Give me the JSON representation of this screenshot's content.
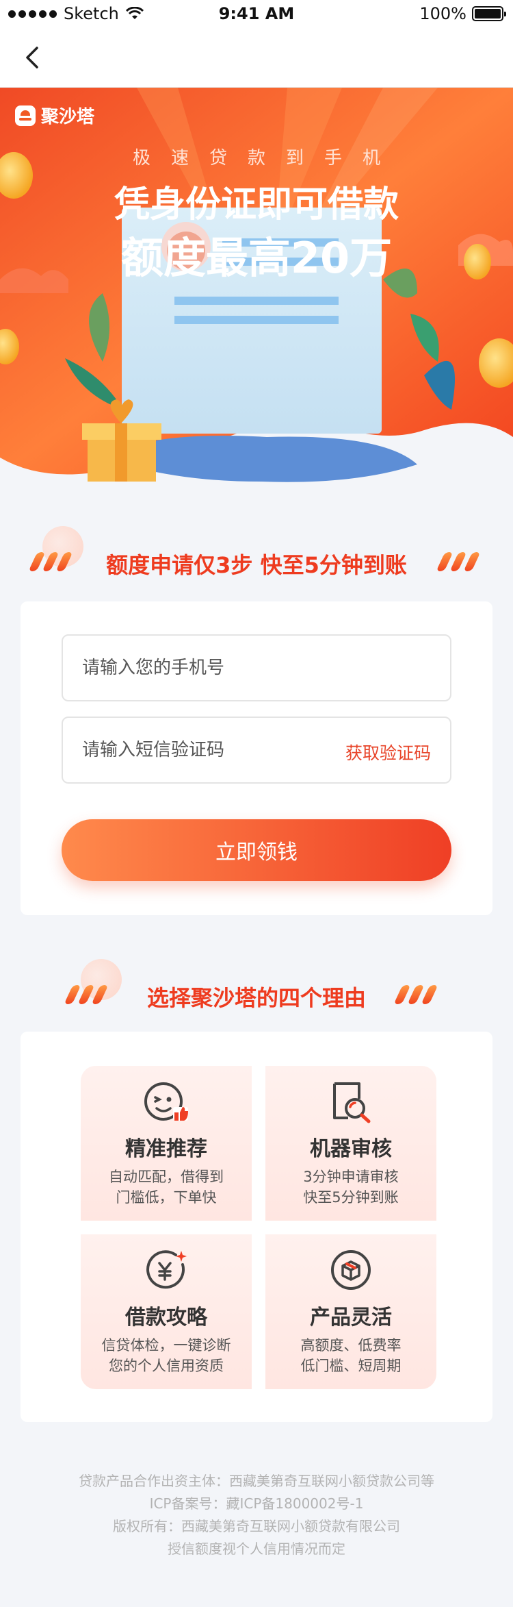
{
  "status_bar": {
    "carrier": "Sketch",
    "time": "9:41 AM",
    "battery": "100%",
    "battery_level": 1.0
  },
  "nav": {
    "back_icon": "chevron-left-icon"
  },
  "hero": {
    "logo_text": "聚沙塔",
    "subtitle": "极速贷款到手机",
    "title_line1": "凭身份证即可借款",
    "title_line2": "额度最高20万"
  },
  "apply_section": {
    "title": "额度申请仅3步 快至5分钟到账"
  },
  "form": {
    "phone_placeholder": "请输入您的手机号",
    "code_placeholder": "请输入短信验证码",
    "get_code_label": "获取验证码",
    "submit_label": "立即领钱"
  },
  "reasons_section": {
    "title": "选择聚沙塔的四个理由",
    "items": [
      {
        "icon": "smiley-thumbs-up-icon",
        "title": "精准推荐",
        "desc_line1": "自动匹配，借得到",
        "desc_line2": "门槛低，下单快"
      },
      {
        "icon": "search-document-icon",
        "title": "机器审核",
        "desc_line1": "3分钟申请审核",
        "desc_line2": "快至5分钟到账"
      },
      {
        "icon": "yuan-coin-icon",
        "title": "借款攻略",
        "desc_line1": "信贷体检，一键诊断",
        "desc_line2": "您的个人信用资质"
      },
      {
        "icon": "product-box-icon",
        "title": "产品灵活",
        "desc_line1": "高额度、低费率",
        "desc_line2": "低门槛、短周期"
      }
    ]
  },
  "footer": {
    "line1": "贷款产品合作出资主体：西藏美第奇互联网小额贷款公司等",
    "line2": "ICP备案号：藏ICP备1800002号-1",
    "line3": "版权所有：西藏美第奇互联网小额贷款有限公司",
    "line4": "授信额度视个人信用情况而定"
  },
  "colors": {
    "accent": "#ef3f25",
    "accent_light": "#ff8a4c",
    "page_bg": "#f3f5f9",
    "reason_bg": "#fff1ee"
  }
}
